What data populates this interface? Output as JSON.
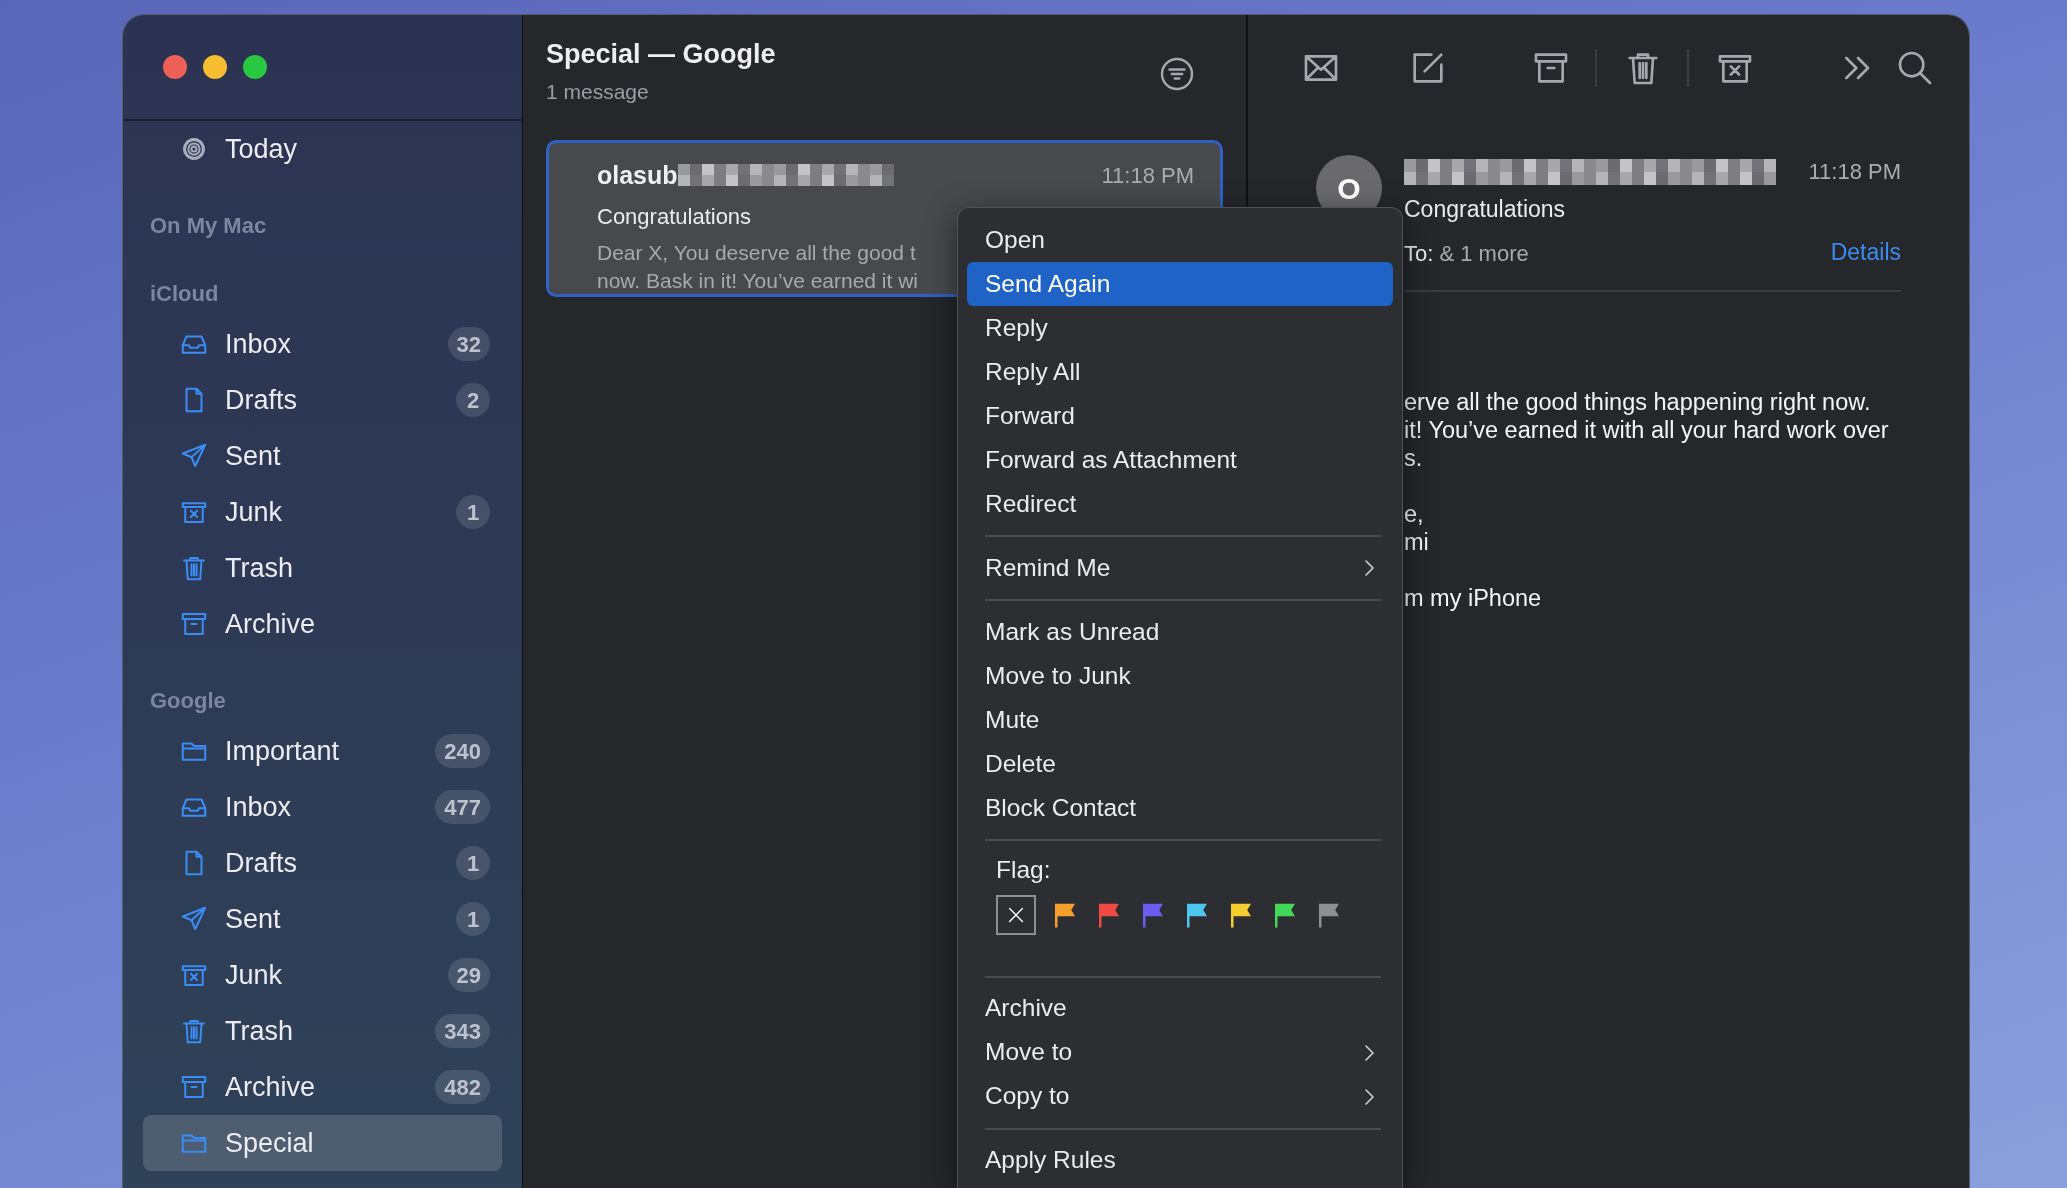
{
  "sidebar": {
    "favorites": [
      {
        "label": "Today",
        "kind": "today",
        "selected": false
      }
    ],
    "sections": [
      {
        "title": "On My Mac"
      },
      {
        "title": "iCloud",
        "items": [
          {
            "label": "Inbox",
            "kind": "inbox",
            "count": "32",
            "selected": false
          },
          {
            "label": "Drafts",
            "kind": "drafts",
            "count": "2",
            "selected": false
          },
          {
            "label": "Sent",
            "kind": "sent",
            "selected": false
          },
          {
            "label": "Junk",
            "kind": "junk",
            "count": "1",
            "selected": false
          },
          {
            "label": "Trash",
            "kind": "trash",
            "selected": false
          },
          {
            "label": "Archive",
            "kind": "archive",
            "selected": false
          }
        ]
      },
      {
        "title": "Google",
        "items": [
          {
            "label": "Important",
            "kind": "folder",
            "count": "240",
            "selected": false
          },
          {
            "label": "Inbox",
            "kind": "inbox",
            "count": "477",
            "selected": false
          },
          {
            "label": "Drafts",
            "kind": "drafts",
            "count": "1",
            "selected": false
          },
          {
            "label": "Sent",
            "kind": "sent",
            "count": "1",
            "selected": false
          },
          {
            "label": "Junk",
            "kind": "junk",
            "count": "29",
            "selected": false
          },
          {
            "label": "Trash",
            "kind": "trash",
            "count": "343",
            "selected": false
          },
          {
            "label": "Archive",
            "kind": "archive",
            "count": "482",
            "selected": false
          },
          {
            "label": "Special",
            "kind": "folder",
            "selected": true
          }
        ]
      }
    ]
  },
  "message_list": {
    "title": "Special — Google",
    "count": "1 message",
    "messages": [
      {
        "sender": "olasub",
        "sender_redacted": true,
        "time": "11:18 PM",
        "subject": "Congratulations",
        "preview": [
          "Dear X, You deserve all the good t",
          "now. Bask in it! You’ve earned it wi"
        ],
        "selected": true
      }
    ]
  },
  "toolbar": [
    {
      "kind": "get-mail"
    },
    {
      "kind": "compose"
    },
    {
      "kind": "archive"
    },
    {
      "kind": "separator"
    },
    {
      "kind": "trash"
    },
    {
      "kind": "separator"
    },
    {
      "kind": "junk"
    },
    {
      "kind": "more"
    },
    {
      "kind": "search"
    }
  ],
  "reader": {
    "avatar": "O",
    "sender_redacted": true,
    "time": "11:18 PM",
    "subject": "Congratulations",
    "to_label": "To:",
    "to": "& 1 more",
    "details": "Details",
    "body": [
      {
        "lines": [
          "erve all the good things happening right now.",
          "it! You’ve earned it with all your hard work over",
          "s."
        ]
      },
      {
        "lines": [
          "e,",
          "mi"
        ]
      },
      {
        "lines": [
          "m my iPhone"
        ]
      }
    ]
  },
  "context_menu": {
    "items": [
      {
        "kind": "item",
        "label": "Open",
        "selected": false
      },
      {
        "kind": "item",
        "label": "Send Again",
        "selected": true
      },
      {
        "kind": "item",
        "label": "Reply",
        "selected": false
      },
      {
        "kind": "item",
        "label": "Reply All",
        "selected": false
      },
      {
        "kind": "item",
        "label": "Forward",
        "selected": false
      },
      {
        "kind": "item",
        "label": "Forward as Attachment",
        "selected": false
      },
      {
        "kind": "item",
        "label": "Redirect",
        "selected": false
      },
      {
        "kind": "separator"
      },
      {
        "kind": "submenu",
        "label": "Remind Me",
        "selected": false
      },
      {
        "kind": "separator"
      },
      {
        "kind": "item",
        "label": "Mark as Unread",
        "selected": false
      },
      {
        "kind": "item",
        "label": "Move to Junk",
        "selected": false
      },
      {
        "kind": "item",
        "label": "Mute",
        "selected": false
      },
      {
        "kind": "item",
        "label": "Delete",
        "selected": false
      },
      {
        "kind": "item",
        "label": "Block Contact",
        "selected": false
      },
      {
        "kind": "separator"
      },
      {
        "kind": "flags",
        "label": "Flag:",
        "flags": [
          {
            "color": "#f5a02c"
          },
          {
            "color": "#ef4a43"
          },
          {
            "color": "#6a5cf0"
          },
          {
            "color": "#4fc6ef"
          },
          {
            "color": "#f6cd2f"
          },
          {
            "color": "#44d85a"
          },
          {
            "color": "#8e8e93"
          }
        ]
      },
      {
        "kind": "separator"
      },
      {
        "kind": "item",
        "label": "Archive",
        "selected": false
      },
      {
        "kind": "submenu",
        "label": "Move to",
        "selected": false
      },
      {
        "kind": "submenu",
        "label": "Copy to",
        "selected": false
      },
      {
        "kind": "separator"
      },
      {
        "kind": "item",
        "label": "Apply Rules",
        "selected": false
      }
    ]
  }
}
